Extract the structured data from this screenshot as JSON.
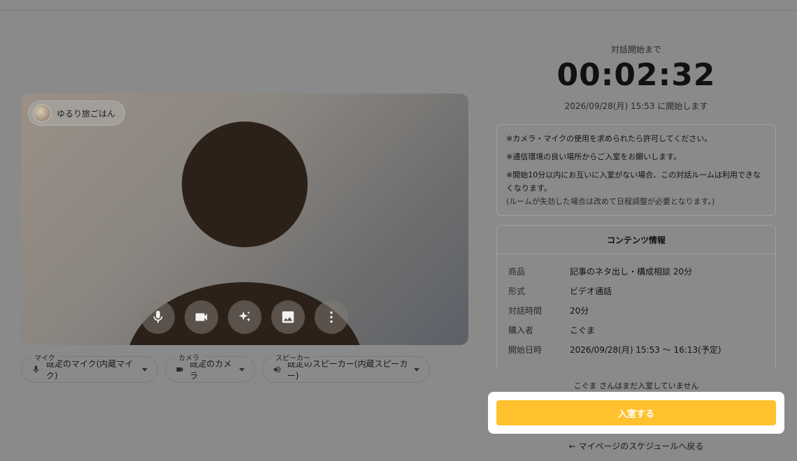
{
  "video": {
    "participant_name": "ゆるり旅ごはん",
    "controls": [
      {
        "icon": "microphone-icon"
      },
      {
        "icon": "camera-icon"
      },
      {
        "icon": "sparkle-effects-icon"
      },
      {
        "icon": "image-background-icon"
      },
      {
        "icon": "more-vertical-icon"
      }
    ]
  },
  "devices": {
    "mic": {
      "label": "マイク",
      "value": "既定のマイク(内蔵マイク)",
      "icon": "microphone-icon"
    },
    "camera": {
      "label": "カメラ",
      "value": "既定のカメラ",
      "icon": "camera-icon"
    },
    "speaker": {
      "label": "スピーカー",
      "value": "既定のスピーカー(内蔵スピーカー)",
      "icon": "speaker-icon"
    }
  },
  "countdown": {
    "label": "対話開始まで",
    "time": "00:02:32",
    "start_note": "2026/09/28(月) 15:53 に開始します"
  },
  "notice": {
    "line1": "※カメラ・マイクの使用を求められたら許可してください。",
    "line2": "※通信環境の良い場所からご入室をお願いします。",
    "line3": "※開始10分以内にお互いに入室がない場合、この対話ルームは利用できなくなります。",
    "line4": "(ルームが失効した場合は改めて日程調整が必要となります。)"
  },
  "content_info": {
    "title": "コンテンツ情報",
    "rows": [
      {
        "key": "商品",
        "value": "記事のネタ出し・構成相談 20分"
      },
      {
        "key": "形式",
        "value": "ビデオ通話"
      },
      {
        "key": "対話時間",
        "value": "20分"
      },
      {
        "key": "購入者",
        "value": "こぐま"
      },
      {
        "key": "開始日時",
        "value": "2026/09/28(月) 15:53 〜 16:13(予定)"
      }
    ]
  },
  "status": {
    "waiting": "こぐま さんはまだ入室していません"
  },
  "actions": {
    "enter_label": "入室する",
    "enter_color": "#ffc22e",
    "back_label": "← マイページのスケジュールへ戻る"
  }
}
